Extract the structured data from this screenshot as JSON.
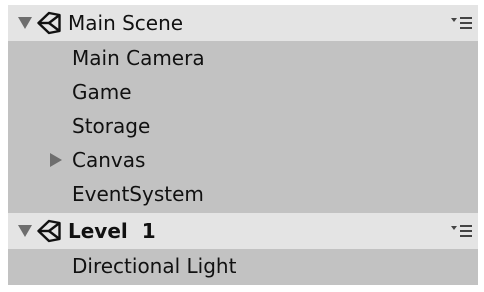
{
  "hierarchy": {
    "scenes": [
      {
        "title": "Main Scene",
        "expanded": true,
        "icon": "unity-logo-icon",
        "menu_icon": "scene-menu-icon",
        "objects": [
          {
            "label": "Main Camera",
            "has_children": false
          },
          {
            "label": "Game",
            "has_children": false
          },
          {
            "label": "Storage",
            "has_children": false
          },
          {
            "label": "Canvas",
            "has_children": true,
            "expanded": false
          },
          {
            "label": "EventSystem",
            "has_children": false
          }
        ]
      },
      {
        "title": "Level  1",
        "expanded": true,
        "icon": "unity-logo-icon",
        "menu_icon": "scene-menu-icon",
        "objects": [
          {
            "label": "Directional Light",
            "has_children": false
          }
        ]
      }
    ]
  },
  "colors": {
    "panel_background": "#c2c2c2",
    "header_background": "#e4e4e4",
    "text": "#111111",
    "arrow": "#6e6e6e"
  }
}
